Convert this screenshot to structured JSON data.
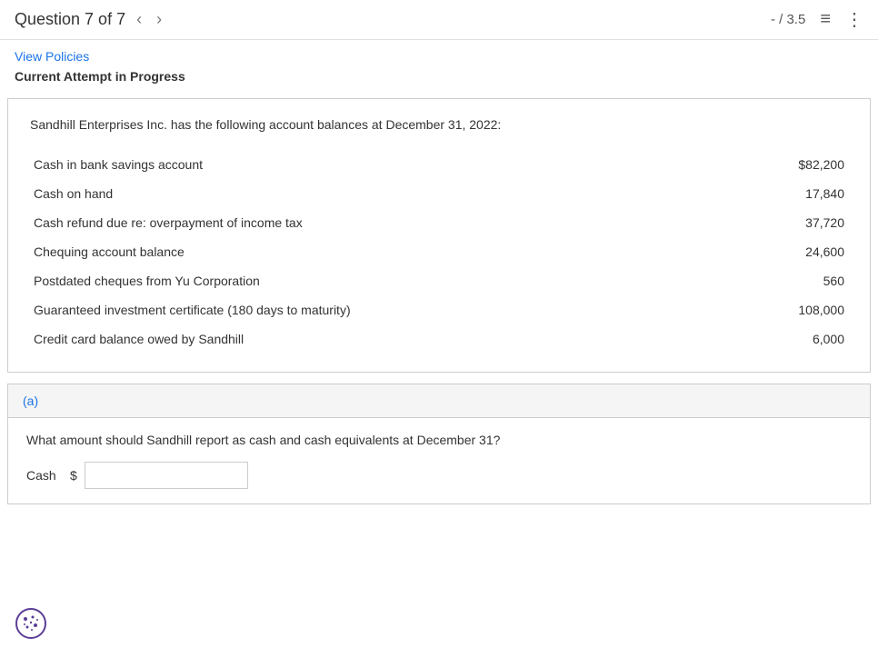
{
  "header": {
    "question_label": "Question 7 of 7",
    "score": "- / 3.5",
    "nav_prev": "‹",
    "nav_next": "›",
    "list_icon": "≡",
    "more_icon": "⋮"
  },
  "sub_header": {
    "view_policies_label": "View Policies",
    "attempt_status": "Current Attempt in Progress"
  },
  "question": {
    "intro": "Sandhill Enterprises Inc. has the following account balances at December 31, 2022:",
    "accounts": [
      {
        "label": "Cash in bank savings account",
        "value": "$82,200"
      },
      {
        "label": "Cash on hand",
        "value": "17,840"
      },
      {
        "label": "Cash refund due re: overpayment of income tax",
        "value": "37,720"
      },
      {
        "label": "Chequing account balance",
        "value": "24,600"
      },
      {
        "label": "Postdated cheques from Yu Corporation",
        "value": "560"
      },
      {
        "label": "Guaranteed investment certificate (180 days to maturity)",
        "value": "108,000"
      },
      {
        "label": "Credit card balance owed by Sandhill",
        "value": "6,000"
      }
    ]
  },
  "part_a": {
    "label": "(a)",
    "question": "What amount should Sandhill report as cash and cash equivalents at December 31?",
    "input_label": "Cash",
    "dollar_sign": "$",
    "input_placeholder": ""
  }
}
